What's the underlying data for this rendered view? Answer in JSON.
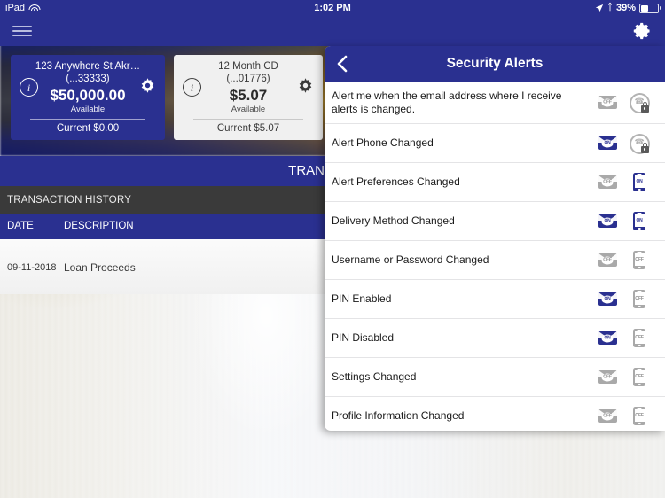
{
  "status_bar": {
    "device": "iPad",
    "wifi_icon": "wifi-icon",
    "time": "1:02 PM",
    "location_icon": "location-arrow-icon",
    "bluetooth_icon": "bluetooth-icon",
    "battery_percent": "39%",
    "battery_icon": "battery-icon"
  },
  "nav": {
    "menu_icon": "hamburger-menu-icon",
    "settings_icon": "gear-icon"
  },
  "accounts": [
    {
      "name": "123 Anywhere St Akr…",
      "number": "(...33333)",
      "amount": "$50,000.00",
      "amount_label": "Available",
      "current": "Current $0.00",
      "info_icon": "info-icon",
      "gear_icon": "gear-icon"
    },
    {
      "name": "12 Month CD",
      "number": "(...01776)",
      "amount": "$5.07",
      "amount_label": "Available",
      "current": "Current $5.07",
      "info_icon": "info-icon",
      "gear_icon": "gear-icon"
    }
  ],
  "transactions": {
    "section_title": "TRANS",
    "history_header": "TRANSACTION HISTORY",
    "columns": [
      "DATE",
      "DESCRIPTION"
    ],
    "rows": [
      {
        "date": "09-11-2018",
        "description": "Loan Proceeds"
      }
    ]
  },
  "panel": {
    "title": "Security Alerts",
    "back_icon": "back-chevron-icon",
    "alerts": [
      {
        "label": "Alert me when the email address where I receive alerts is changed.",
        "email": "OFF",
        "email_state": "off",
        "second_icon": "phone-lock-icon",
        "second_state": "off",
        "second_label": ""
      },
      {
        "label": "Alert Phone Changed",
        "email": "ON",
        "email_state": "on",
        "second_icon": "phone-lock-icon",
        "second_state": "off",
        "second_label": ""
      },
      {
        "label": "Alert Preferences Changed",
        "email": "OFF",
        "email_state": "off",
        "second_icon": "phone-icon",
        "second_state": "on",
        "second_label": "ON"
      },
      {
        "label": "Delivery Method Changed",
        "email": "ON",
        "email_state": "on",
        "second_icon": "phone-icon",
        "second_state": "on",
        "second_label": "ON"
      },
      {
        "label": "Username or Password Changed",
        "email": "OFF",
        "email_state": "off",
        "second_icon": "phone-icon",
        "second_state": "off",
        "second_label": "OFF"
      },
      {
        "label": "PIN Enabled",
        "email": "ON",
        "email_state": "on",
        "second_icon": "phone-icon",
        "second_state": "off",
        "second_label": "OFF"
      },
      {
        "label": "PIN Disabled",
        "email": "ON",
        "email_state": "on",
        "second_icon": "phone-icon",
        "second_state": "off",
        "second_label": "OFF"
      },
      {
        "label": "Settings Changed",
        "email": "OFF",
        "email_state": "off",
        "second_icon": "phone-icon",
        "second_state": "off",
        "second_label": "OFF"
      },
      {
        "label": "Profile Information Changed",
        "email": "OFF",
        "email_state": "off",
        "second_icon": "phone-icon",
        "second_state": "off",
        "second_label": "OFF"
      }
    ]
  },
  "colors": {
    "brand_blue": "#2a3090",
    "dark_bar": "#3a3a3a",
    "icon_off_gray": "#a9a9a9"
  }
}
